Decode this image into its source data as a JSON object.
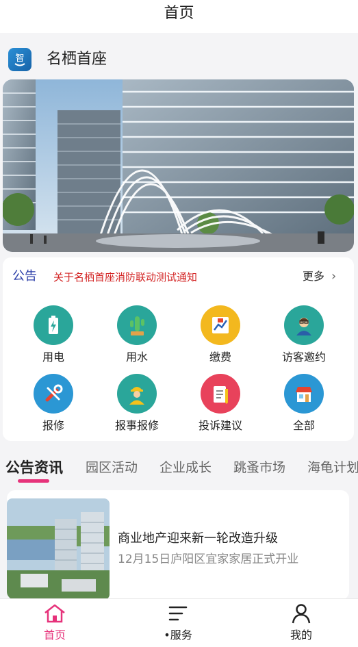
{
  "header": {
    "title": "首页"
  },
  "app": {
    "name": "名栖首座"
  },
  "notice": {
    "tag": "公告",
    "text": "关于名栖首座消防联动测试通知",
    "more": "更多"
  },
  "grid": [
    {
      "label": "用电",
      "icon": "battery-icon",
      "color": "#2aa69a"
    },
    {
      "label": "用水",
      "icon": "cactus-icon",
      "color": "#2aa69a"
    },
    {
      "label": "缴费",
      "icon": "bill-chart-icon",
      "color": "#f3b81e"
    },
    {
      "label": "访客邀约",
      "icon": "visitor-icon",
      "color": "#2aa69a"
    },
    {
      "label": "报修",
      "icon": "wrench-icon",
      "color": "#2b97d4"
    },
    {
      "label": "报事报修",
      "icon": "worker-icon",
      "color": "#2aa69a"
    },
    {
      "label": "投诉建议",
      "icon": "clipboard-icon",
      "color": "#e8425b"
    },
    {
      "label": "全部",
      "icon": "store-icon",
      "color": "#2b97d4"
    }
  ],
  "tabs": [
    "公告资讯",
    "园区活动",
    "企业成长",
    "跳蚤市场",
    "海龟计划"
  ],
  "news": [
    {
      "title": "商业地产迎来新一轮改造升级",
      "subtitle": "12月15日庐阳区宜家家居正式开业"
    }
  ],
  "bottom_nav": [
    {
      "label": "首页",
      "icon": "home-icon",
      "active": true
    },
    {
      "label": "服务",
      "icon": "menu-lines-icon",
      "active": false
    },
    {
      "label": "我的",
      "icon": "person-icon",
      "active": false
    }
  ],
  "colors": {
    "accent": "#e6327a",
    "notice_tag": "#2b3ea8",
    "notice_text": "#d32424"
  }
}
